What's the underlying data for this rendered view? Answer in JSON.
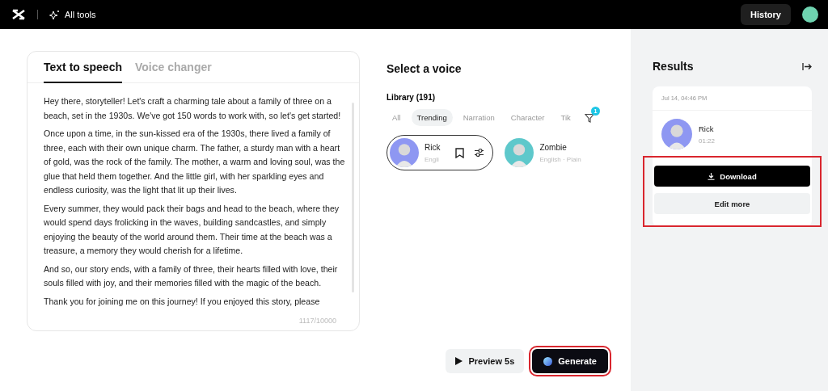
{
  "header": {
    "tools_label": "All tools",
    "history_button": "History"
  },
  "editor": {
    "tabs": [
      {
        "label": "Text to speech",
        "selected": true
      },
      {
        "label": "Voice changer",
        "selected": false
      }
    ],
    "paragraphs": [
      "Hey there, storyteller! Let's craft a charming tale about a family of three on a beach, set in the 1930s. We've got 150 words to work with, so let's get started!",
      "Once upon a time, in the sun-kissed era of the 1930s, there lived a family of three, each with their own unique charm. The father, a sturdy man with a heart of gold, was the rock of the family. The mother, a warm and loving soul, was the glue that held them together. And the little girl, with her sparkling eyes and endless curiosity, was the light that lit up their lives.",
      "Every summer, they would pack their bags and head to the beach, where they would spend days frolicking in the waves, building sandcastles, and simply enjoying the beauty of the world around them. Their time at the beach was a treasure, a memory they would cherish for a lifetime.",
      "And so, our story ends, with a family of three, their hearts filled with love, their souls filled with joy, and their memories filled with the magic of the beach.",
      "Thank you for joining me on this journey! If you enjoyed this story, please"
    ],
    "counter": "1117/10000"
  },
  "voice_panel": {
    "title": "Select a voice",
    "library_label": "Library (191)",
    "filters": [
      {
        "label": "All",
        "selected": false
      },
      {
        "label": "Trending",
        "selected": true
      },
      {
        "label": "Narration",
        "selected": false
      },
      {
        "label": "Character",
        "selected": false
      },
      {
        "label": "Tik",
        "selected": false
      }
    ],
    "filter_badge": "1",
    "voices": [
      {
        "name": "Rick",
        "subtitle": "Engli",
        "selected": true,
        "color": "#8e97f2"
      },
      {
        "name": "Zombie",
        "subtitle": "English · Plain",
        "selected": false,
        "color": "#5ec8cb"
      }
    ]
  },
  "actions": {
    "preview_button": "Preview 5s",
    "generate_button": "Generate",
    "generate_highlighted": true
  },
  "results": {
    "title": "Results",
    "items": [
      {
        "date": "Jul 14, 04:46 PM",
        "voice": "Rick",
        "duration": "01:22",
        "color": "#8e97f2",
        "download_button": "Download",
        "edit_button": "Edit more",
        "highlighted": true
      }
    ]
  }
}
